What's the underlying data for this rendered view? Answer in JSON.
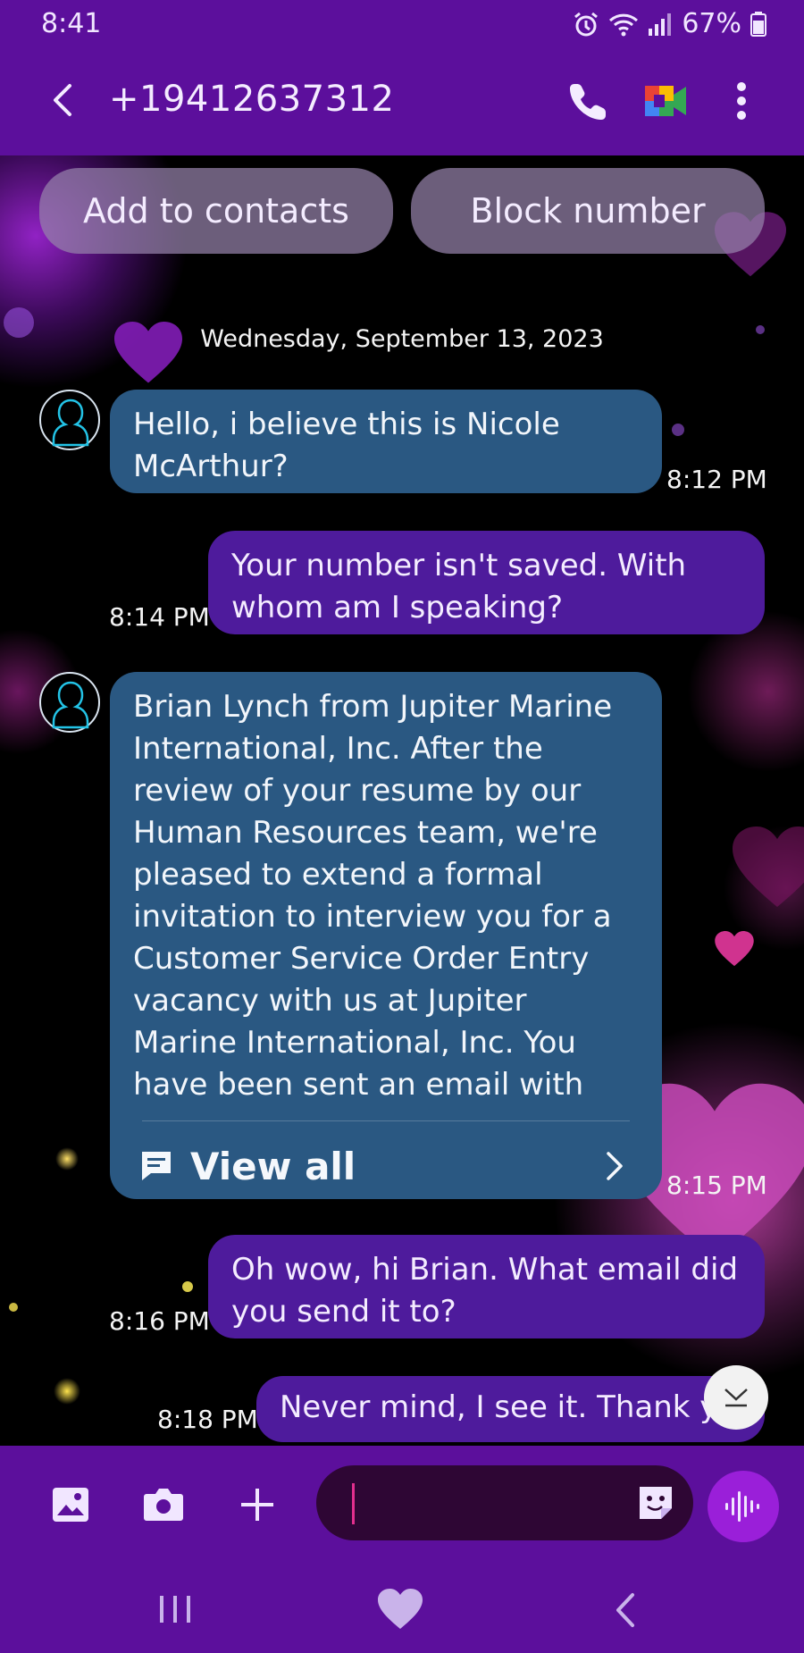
{
  "status_bar": {
    "time": "8:41",
    "battery_percent": "67%",
    "icons": [
      "alarm-icon",
      "wifi-icon",
      "signal-icon",
      "battery-icon"
    ]
  },
  "header": {
    "title": "+19412637312",
    "icons": [
      "back-arrow-icon",
      "phone-icon",
      "video-call-icon",
      "more-vert-icon"
    ]
  },
  "actions": {
    "add_to_contacts": "Add to contacts",
    "block_number": "Block number"
  },
  "conversation": {
    "date": "Wednesday, September 13, 2023",
    "messages": [
      {
        "direction": "incoming",
        "text": "Hello, i believe this is Nicole McArthur?",
        "time": "8:12 PM"
      },
      {
        "direction": "outgoing",
        "text": "Your number isn't saved. With whom am I speaking?",
        "time": "8:14 PM"
      },
      {
        "direction": "incoming",
        "text": "Brian Lynch from Jupiter Marine International, Inc. After the review of your resume by our Human Resources team, we're pleased to extend a formal invitation to interview you for a Customer Service Order Entry vacancy with us at Jupiter Marine International, Inc. You have been sent an email with inst",
        "time": "8:15 PM",
        "view_all_label": "View all"
      },
      {
        "direction": "outgoing",
        "text": "Oh wow, hi Brian. What email did you send it to?",
        "time": "8:16 PM"
      },
      {
        "direction": "outgoing",
        "text": "Never mind, I see it. Thank y",
        "time": "8:18 PM"
      }
    ]
  },
  "composer": {
    "input_value": "",
    "icons": [
      "gallery-icon",
      "camera-icon",
      "plus-icon",
      "sticker-icon",
      "voice-record-icon"
    ]
  },
  "nav_bar": {
    "icons": [
      "recents-icon",
      "home-heart-icon",
      "nav-back-icon"
    ]
  },
  "colors": {
    "bar_purple": "#5c0f9c",
    "incoming_bubble": "#2a5882",
    "outgoing_bubble": "#4e1b9c",
    "voice_button": "#9a1fd9",
    "cursor": "#e22f8e"
  }
}
